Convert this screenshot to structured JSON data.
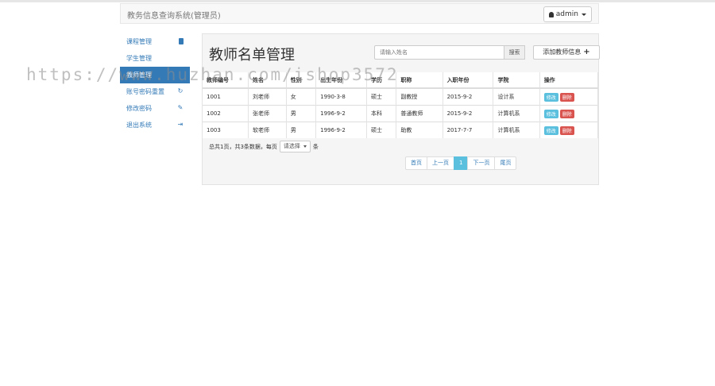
{
  "navbar": {
    "brand": "教务信息查询系统(管理员)",
    "user_label": "admin"
  },
  "sidebar": {
    "items": [
      {
        "label": "课程管理",
        "icon": "book-icon"
      },
      {
        "label": "学生管理",
        "icon": ""
      },
      {
        "label": "教师管理",
        "icon": ""
      },
      {
        "label": "账号密码重置",
        "icon": "refresh-icon"
      },
      {
        "label": "修改密码",
        "icon": "pencil-icon"
      },
      {
        "label": "退出系统",
        "icon": "logout-icon"
      }
    ]
  },
  "main": {
    "title": "教师名单管理",
    "search_placeholder": "请输入姓名",
    "search_button": "搜索",
    "add_button": "添加教师信息",
    "columns": [
      "教师编号",
      "姓名",
      "性别",
      "出生年份",
      "学历",
      "职称",
      "入职年份",
      "学院",
      "操作"
    ],
    "rows": [
      [
        "1001",
        "刘老师",
        "女",
        "1990-3-8",
        "硕士",
        "副教授",
        "2015-9-2",
        "设计系"
      ],
      [
        "1002",
        "张老师",
        "男",
        "1996-9-2",
        "本科",
        "普通教师",
        "2015-9-2",
        "计算机系"
      ],
      [
        "1003",
        "软老师",
        "男",
        "1996-9-2",
        "硕士",
        "助教",
        "2017-7-7",
        "计算机系"
      ]
    ],
    "edit_label": "修改",
    "delete_label": "删除",
    "summary_prefix": "总共1页，共3条数据，每页",
    "per_page_select": "请选择",
    "summary_suffix": "条"
  },
  "pagination": {
    "first": "首页",
    "prev": "上一页",
    "current": "1",
    "next": "下一页",
    "last": "尾页"
  },
  "watermark": "https://www.huzhan.com/ishop3572"
}
